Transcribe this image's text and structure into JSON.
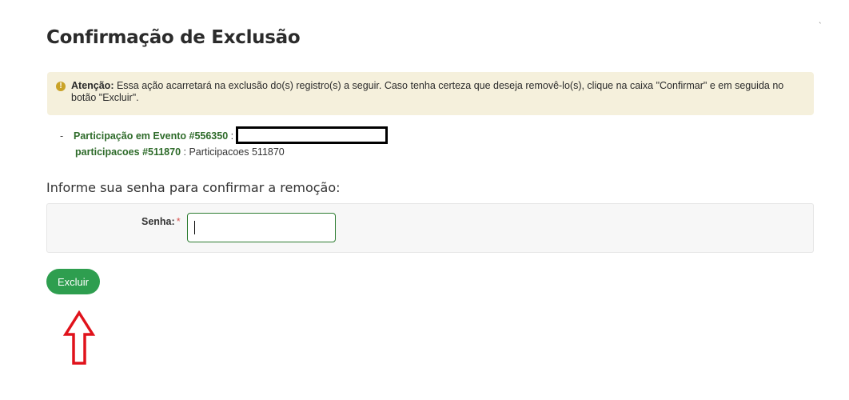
{
  "page": {
    "title": "Confirmação de Exclusão"
  },
  "alert": {
    "icon": "warning-icon",
    "icon_glyph": "!",
    "strong": "Atenção:",
    "text": " Essa ação acarretará na exclusão do(s) registro(s) a seguir. Caso tenha certeza que deseja removê-lo(s), clique na caixa \"Confirmar\" e em seguida no botão \"Excluir\"."
  },
  "records": [
    {
      "dash": "-",
      "link": "Participação em Evento #556350",
      "sep": " :",
      "desc": ""
    },
    {
      "link": "participacoes #511870",
      "sep": " : ",
      "desc": "Participacoes 511870"
    }
  ],
  "form": {
    "heading": "Informe sua senha para confirmar a remoção:",
    "password_label": "Senha:",
    "required_mark": "*",
    "password_value": ""
  },
  "actions": {
    "delete_label": "Excluir"
  },
  "annotation": {
    "arrow": "red-up-arrow",
    "color": "#e0121b"
  }
}
